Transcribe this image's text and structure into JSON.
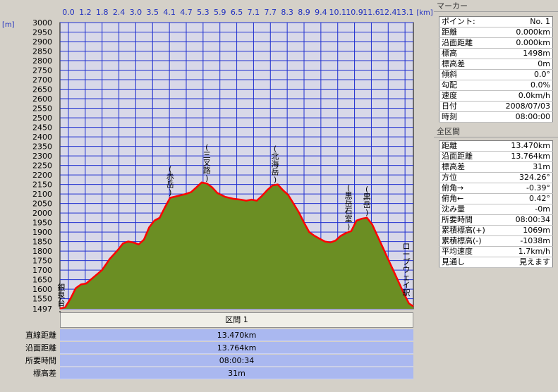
{
  "chart_data": {
    "type": "area",
    "x_unit": "[km]",
    "y_unit": "[m]",
    "xlim": [
      0,
      13.47
    ],
    "ylim": [
      1497,
      3000
    ],
    "x_tick_labels": [
      "0.0",
      "1.2",
      "1.8",
      "2.4",
      "3.0",
      "3.5",
      "4.1",
      "4.7",
      "5.3",
      "5.9",
      "6.5",
      "7.1",
      "7.7",
      "8.3",
      "8.9",
      "9.4",
      "10.1",
      "10.9",
      "11.6",
      "12.4",
      "13.1"
    ],
    "y_tick_labels": [
      "3000",
      "2950",
      "2900",
      "2850",
      "2800",
      "2750",
      "2700",
      "2650",
      "2600",
      "2550",
      "2500",
      "2450",
      "2400",
      "2350",
      "2300",
      "2250",
      "2200",
      "2150",
      "2100",
      "2050",
      "2000",
      "1950",
      "1900",
      "1850",
      "1800",
      "1750",
      "1700",
      "1650",
      "1600",
      "1550",
      "1497"
    ],
    "y_ticks": [
      3000,
      2950,
      2900,
      2850,
      2800,
      2750,
      2700,
      2650,
      2600,
      2550,
      2500,
      2450,
      2400,
      2350,
      2300,
      2250,
      2200,
      2150,
      2100,
      2050,
      2000,
      1950,
      1900,
      1850,
      1800,
      1750,
      1700,
      1650,
      1600,
      1550,
      1497
    ],
    "profile": {
      "x": [
        0,
        0.2,
        0.4,
        0.6,
        0.8,
        1.0,
        1.3,
        1.6,
        1.9,
        2.2,
        2.4,
        2.6,
        2.8,
        3.0,
        3.2,
        3.4,
        3.6,
        3.8,
        4.0,
        4.2,
        4.5,
        4.8,
        5.0,
        5.2,
        5.4,
        5.6,
        5.8,
        6.0,
        6.3,
        6.6,
        6.9,
        7.1,
        7.3,
        7.5,
        7.7,
        7.9,
        8.1,
        8.3,
        8.5,
        8.7,
        8.9,
        9.1,
        9.3,
        9.5,
        9.7,
        9.9,
        10.1,
        10.3,
        10.5,
        10.7,
        10.9,
        11.1,
        11.3,
        11.5,
        11.7,
        11.9,
        12.1,
        12.3,
        12.5,
        12.7,
        12.9,
        13.1,
        13.3,
        13.47
      ],
      "y": [
        1498,
        1505,
        1550,
        1605,
        1625,
        1630,
        1665,
        1700,
        1760,
        1805,
        1840,
        1850,
        1845,
        1835,
        1860,
        1925,
        1960,
        1975,
        2030,
        2080,
        2090,
        2100,
        2110,
        2135,
        2160,
        2155,
        2135,
        2105,
        2085,
        2075,
        2070,
        2065,
        2070,
        2065,
        2090,
        2120,
        2145,
        2150,
        2120,
        2095,
        2050,
        2005,
        1950,
        1900,
        1880,
        1865,
        1850,
        1845,
        1855,
        1880,
        1895,
        1905,
        1960,
        1970,
        1975,
        1940,
        1880,
        1820,
        1760,
        1700,
        1640,
        1580,
        1525,
        1510
      ]
    },
    "annotations": [
      {
        "text": "銀泉台",
        "x": 0.05
      },
      {
        "text": "(赤岳)",
        "x": 4.2
      },
      {
        "text": "(三叉路)",
        "x": 5.6
      },
      {
        "text": "(北海岳)",
        "x": 8.2
      },
      {
        "text": "(黒岳石室)",
        "x": 11.0
      },
      {
        "text": "(黒岳)",
        "x": 11.7
      },
      {
        "text": "ロープウェイ駅",
        "x": 13.2
      }
    ],
    "fill_color": "#6b8e23",
    "line_color": "#ff0000",
    "plot_bg": "#d8d8e8",
    "grid_color": "#2030d0"
  },
  "marker": {
    "title": "マーカー",
    "rows": [
      {
        "label": "ポイント:",
        "value": "No. 1"
      },
      {
        "label": "距離",
        "value": "0.000km"
      },
      {
        "label": "沿面距離",
        "value": "0.000km"
      },
      {
        "label": "標高",
        "value": "1498m"
      },
      {
        "label": "標高差",
        "value": "0m"
      },
      {
        "label": "傾斜",
        "value": "0.0°"
      },
      {
        "label": "勾配",
        "value": "0.0%"
      },
      {
        "label": "速度",
        "value": "0.0km/h"
      },
      {
        "label": "日付",
        "value": "2008/07/03"
      },
      {
        "label": "時刻",
        "value": "08:00:00"
      }
    ]
  },
  "total": {
    "title": "全区間",
    "rows": [
      {
        "label": "距離",
        "value": "13.470km"
      },
      {
        "label": "沿面距離",
        "value": "13.764km"
      },
      {
        "label": "標高差",
        "value": "31m"
      },
      {
        "label": "方位",
        "value": "324.26°"
      },
      {
        "label": "俯角→",
        "value": "-0.39°"
      },
      {
        "label": "俯角←",
        "value": "0.42°"
      },
      {
        "label": "沈み量",
        "value": "-0m"
      },
      {
        "label": "所要時間",
        "value": "08:00:34"
      },
      {
        "label": "累積標高(+)",
        "value": "1069m"
      },
      {
        "label": "累積標高(-)",
        "value": "-1038m"
      },
      {
        "label": "平均速度",
        "value": "1.7km/h"
      },
      {
        "label": "見通し",
        "value": "見えます"
      }
    ]
  },
  "segment": {
    "header": "区間 1",
    "rows": [
      {
        "label": "直線距離",
        "value": "13.470km"
      },
      {
        "label": "沿面距離",
        "value": "13.764km"
      },
      {
        "label": "所要時間",
        "value": "08:00:34"
      },
      {
        "label": "標高差",
        "value": "31m"
      }
    ]
  }
}
